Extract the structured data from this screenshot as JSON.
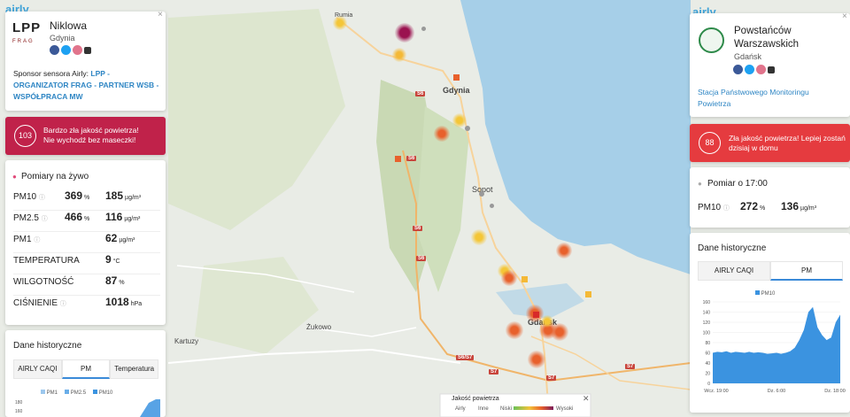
{
  "left_panel": {
    "brand_logo": "airly",
    "lpp_logo": "LPP",
    "frag_logo": "FRAG",
    "street": "Niklowa",
    "city": "Gdynia",
    "sponsor_prefix": "Sponsor sensora Airly:",
    "sponsor_link": "LPP - ORGANIZATOR FRAG - PARTNER WSB - WSPÓŁPRACA MW",
    "alert": {
      "index": "103",
      "title": "Bardzo zła jakość powietrza!",
      "subtitle": "Nie wychodź bez maseczki!",
      "color": "#c0224a"
    },
    "live_title": "Pomiary na żywo",
    "measurements": [
      {
        "label": "PM10",
        "percent": "369",
        "pct_unit": "%",
        "value": "185",
        "unit": "µg/m³",
        "info": true
      },
      {
        "label": "PM2.5",
        "percent": "466",
        "pct_unit": "%",
        "value": "116",
        "unit": "µg/m³",
        "info": true
      },
      {
        "label": "PM1",
        "percent": "",
        "pct_unit": "",
        "value": "62",
        "unit": "µg/m³",
        "info": true
      },
      {
        "label": "TEMPERATURA",
        "percent": "",
        "pct_unit": "",
        "value": "9",
        "unit": "°C",
        "info": false
      },
      {
        "label": "WILGOTNOŚĆ",
        "percent": "",
        "pct_unit": "",
        "value": "87",
        "unit": "%",
        "info": false
      },
      {
        "label": "CIŚNIENIE",
        "percent": "",
        "pct_unit": "",
        "value": "1018",
        "unit": "hPa",
        "info": true
      }
    ],
    "history": {
      "title": "Dane historyczne",
      "tabs": [
        "AIRLY CAQI",
        "PM",
        "Temperatura"
      ],
      "active_tab": 1,
      "legend": [
        "PM1",
        "PM2.5",
        "PM10"
      ],
      "y_ticks": [
        "180",
        "160"
      ]
    }
  },
  "right_panel": {
    "brand_logo": "airly",
    "street": "Powstańców Warszawskich",
    "city": "Gdańsk",
    "station_link": "Stacja Państwowego Monitoringu Powietrza",
    "alert": {
      "index": "88",
      "title": "Zła jakość powietrza!",
      "subtitle_rest": "Lepiej zostań dzisiaj w domu",
      "color": "#e53b3f"
    },
    "measurement_title": "Pomiar o 17:00",
    "measurement": {
      "label": "PM10",
      "percent": "272",
      "pct_unit": "%",
      "value": "136",
      "unit": "µg/m³"
    },
    "history": {
      "title": "Dane historyczne",
      "tabs": [
        "AIRLY CAQI",
        "PM"
      ],
      "active_tab": 1,
      "legend": [
        "PM10"
      ],
      "y_ticks": [
        "160",
        "140",
        "120",
        "100",
        "80",
        "60",
        "40",
        "20",
        "0"
      ],
      "x_ticks": [
        "Wcz. 19:00",
        "Dz. 6:00",
        "Dz. 18:00"
      ]
    }
  },
  "chart_data": {
    "type": "area",
    "title": "",
    "series": [
      {
        "name": "PM10",
        "values": [
          60,
          62,
          61,
          63,
          60,
          62,
          61,
          60,
          62,
          60,
          61,
          60,
          58,
          59,
          60,
          58,
          60,
          63,
          70,
          85,
          105,
          140,
          150,
          110,
          95,
          85,
          90,
          120,
          135
        ]
      }
    ],
    "x_ticks": [
      "Wcz. 19:00",
      "Dz. 6:00",
      "Dz. 18:00"
    ],
    "ylim": [
      0,
      160
    ],
    "color": "#3b93e0"
  },
  "map": {
    "labels": [
      "Gdynia",
      "Sopot",
      "Gdańsk",
      "Żukowo",
      "Kartuzy",
      "Rumia"
    ],
    "roads": [
      "S6",
      "S6",
      "S6",
      "S6",
      "S6/S7",
      "S7",
      "S7",
      "S7"
    ],
    "legend": {
      "title": "Jakość powietrza",
      "items": [
        "Airly",
        "Inne",
        "Niski",
        "Wysoki"
      ]
    }
  },
  "colors": {
    "accent": "#3a8ad8",
    "water": "#a6cfe8",
    "land": "#e9ece6",
    "forest": "#cfdcbd"
  }
}
